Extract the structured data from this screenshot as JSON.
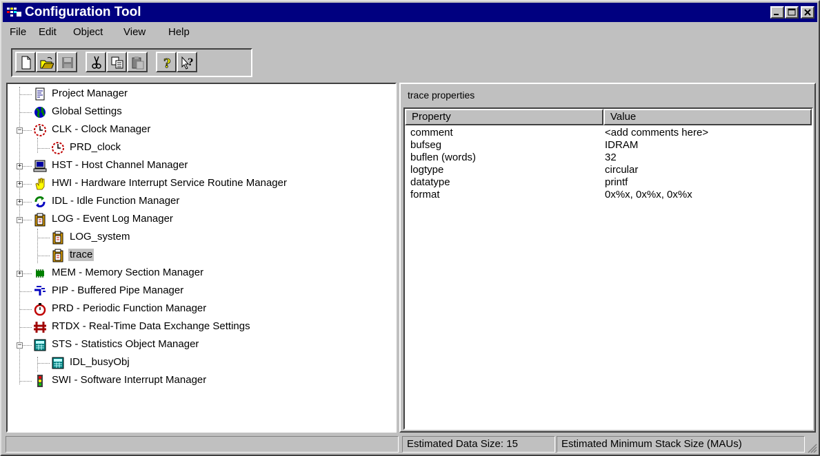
{
  "window": {
    "title": "Configuration Tool"
  },
  "menu": [
    "File",
    "Edit",
    "Object",
    "View",
    "Help"
  ],
  "toolbar": {
    "buttons": [
      "new-icon",
      "open-icon",
      "save-icon",
      "cut-icon",
      "copy-icon",
      "paste-icon",
      "help-icon",
      "context-help-icon"
    ]
  },
  "tree": {
    "items": [
      {
        "label": "Project Manager",
        "icon": "project-manager-icon"
      },
      {
        "label": "Global Settings",
        "icon": "globe-icon"
      },
      {
        "label": "CLK - Clock Manager",
        "icon": "clock-icon",
        "expanded": true
      },
      {
        "label": "PRD_clock",
        "icon": "clock-icon"
      },
      {
        "label": "HST - Host Channel Manager",
        "icon": "computer-icon",
        "expandable": true
      },
      {
        "label": "HWI - Hardware Interrupt Service Routine Manager",
        "icon": "hand-icon",
        "expandable": true
      },
      {
        "label": "IDL - Idle Function Manager",
        "icon": "cycle-icon",
        "expandable": true
      },
      {
        "label": "LOG - Event Log Manager",
        "icon": "log-icon",
        "expanded": true
      },
      {
        "label": "LOG_system",
        "icon": "log-icon"
      },
      {
        "label": "trace",
        "icon": "log-icon",
        "selected": true
      },
      {
        "label": "MEM - Memory Section Manager",
        "icon": "memory-chip-icon",
        "expandable": true
      },
      {
        "label": "PIP - Buffered Pipe Manager",
        "icon": "pipe-icon"
      },
      {
        "label": "PRD - Periodic Function Manager",
        "icon": "stopwatch-icon"
      },
      {
        "label": "RTDX - Real-Time Data Exchange Settings",
        "icon": "rtdx-icon"
      },
      {
        "label": "STS - Statistics Object Manager",
        "icon": "calculator-icon",
        "expanded": true
      },
      {
        "label": "IDL_busyObj",
        "icon": "calculator-icon"
      },
      {
        "label": "SWI - Software Interrupt Manager",
        "icon": "traffic-light-icon"
      }
    ]
  },
  "properties": {
    "title": "trace properties",
    "columns": [
      "Property",
      "Value"
    ],
    "rows": [
      {
        "name": "comment",
        "value": "<add comments here>"
      },
      {
        "name": "bufseg",
        "value": "IDRAM"
      },
      {
        "name": "buflen (words)",
        "value": "32"
      },
      {
        "name": "logtype",
        "value": "circular"
      },
      {
        "name": "datatype",
        "value": "printf"
      },
      {
        "name": "format",
        "value": "0x%x, 0x%x, 0x%x"
      }
    ]
  },
  "status": {
    "data_size": "Estimated Data Size: 15",
    "stack_size": "Estimated Minimum Stack Size (MAUs)"
  },
  "colors": {
    "titlebar": "#000080",
    "face": "#c0c0c0"
  }
}
